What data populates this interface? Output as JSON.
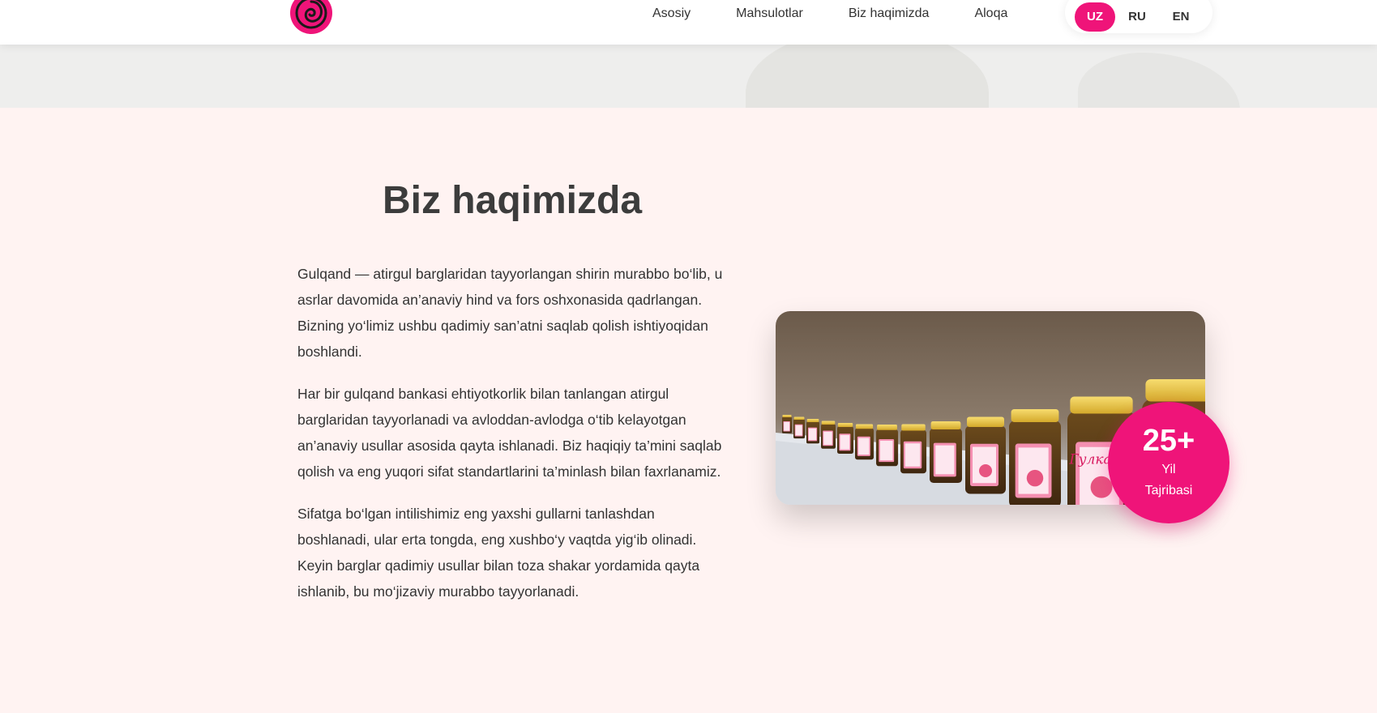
{
  "header": {
    "nav": [
      {
        "label": "Asosiy"
      },
      {
        "label": "Mahsulotlar"
      },
      {
        "label": "Biz haqimizda"
      },
      {
        "label": "Aloqa"
      }
    ],
    "languages": [
      {
        "label": "UZ",
        "active": true
      },
      {
        "label": "RU",
        "active": false
      },
      {
        "label": "EN",
        "active": false
      }
    ]
  },
  "about": {
    "title": "Biz haqimizda",
    "paragraphs": [
      "Gulqand — atirgul barglaridan tayyorlangan shirin murabbo bo‘lib, u asrlar davomida an’anaviy hind va fors oshxonasida qadrlangan. Bizning yo‘limiz ushbu qadimiy san’atni saqlab qolish ishtiyoqidan boshlandi.",
      "Har bir gulqand bankasi ehtiyotkorlik bilan tanlangan atirgul barglaridan tayyorlanadi va avloddan-avlodga o‘tib kelayotgan an’anaviy usullar asosida qayta ishlanadi. Biz haqiqiy ta’mini saqlab qolish va eng yuqori sifat standartlarini ta’minlash bilan faxrlanamiz.",
      "Sifatga bo‘lgan intilishimiz eng yaxshi gullarni tanlashdan boshlanadi, ular erta tongda, eng xushbo‘y vaqtda yig‘ib olinadi. Keyin barglar qadimiy usullar bilan toza shakar yordamida qayta ishlanib, bu mo‘jizaviy murabbo tayyorlanadi."
    ],
    "jar_label": "Гулканд",
    "badge": {
      "number": "25+",
      "line1": "Yil",
      "line2": "Tajribasi"
    }
  },
  "colors": {
    "accent": "#ef1479",
    "section_bg": "#fff3f2",
    "jar_lid": "#f2c94c",
    "jam": "#5a3a16"
  },
  "icons": {
    "logo": "rose-spiral-icon"
  }
}
